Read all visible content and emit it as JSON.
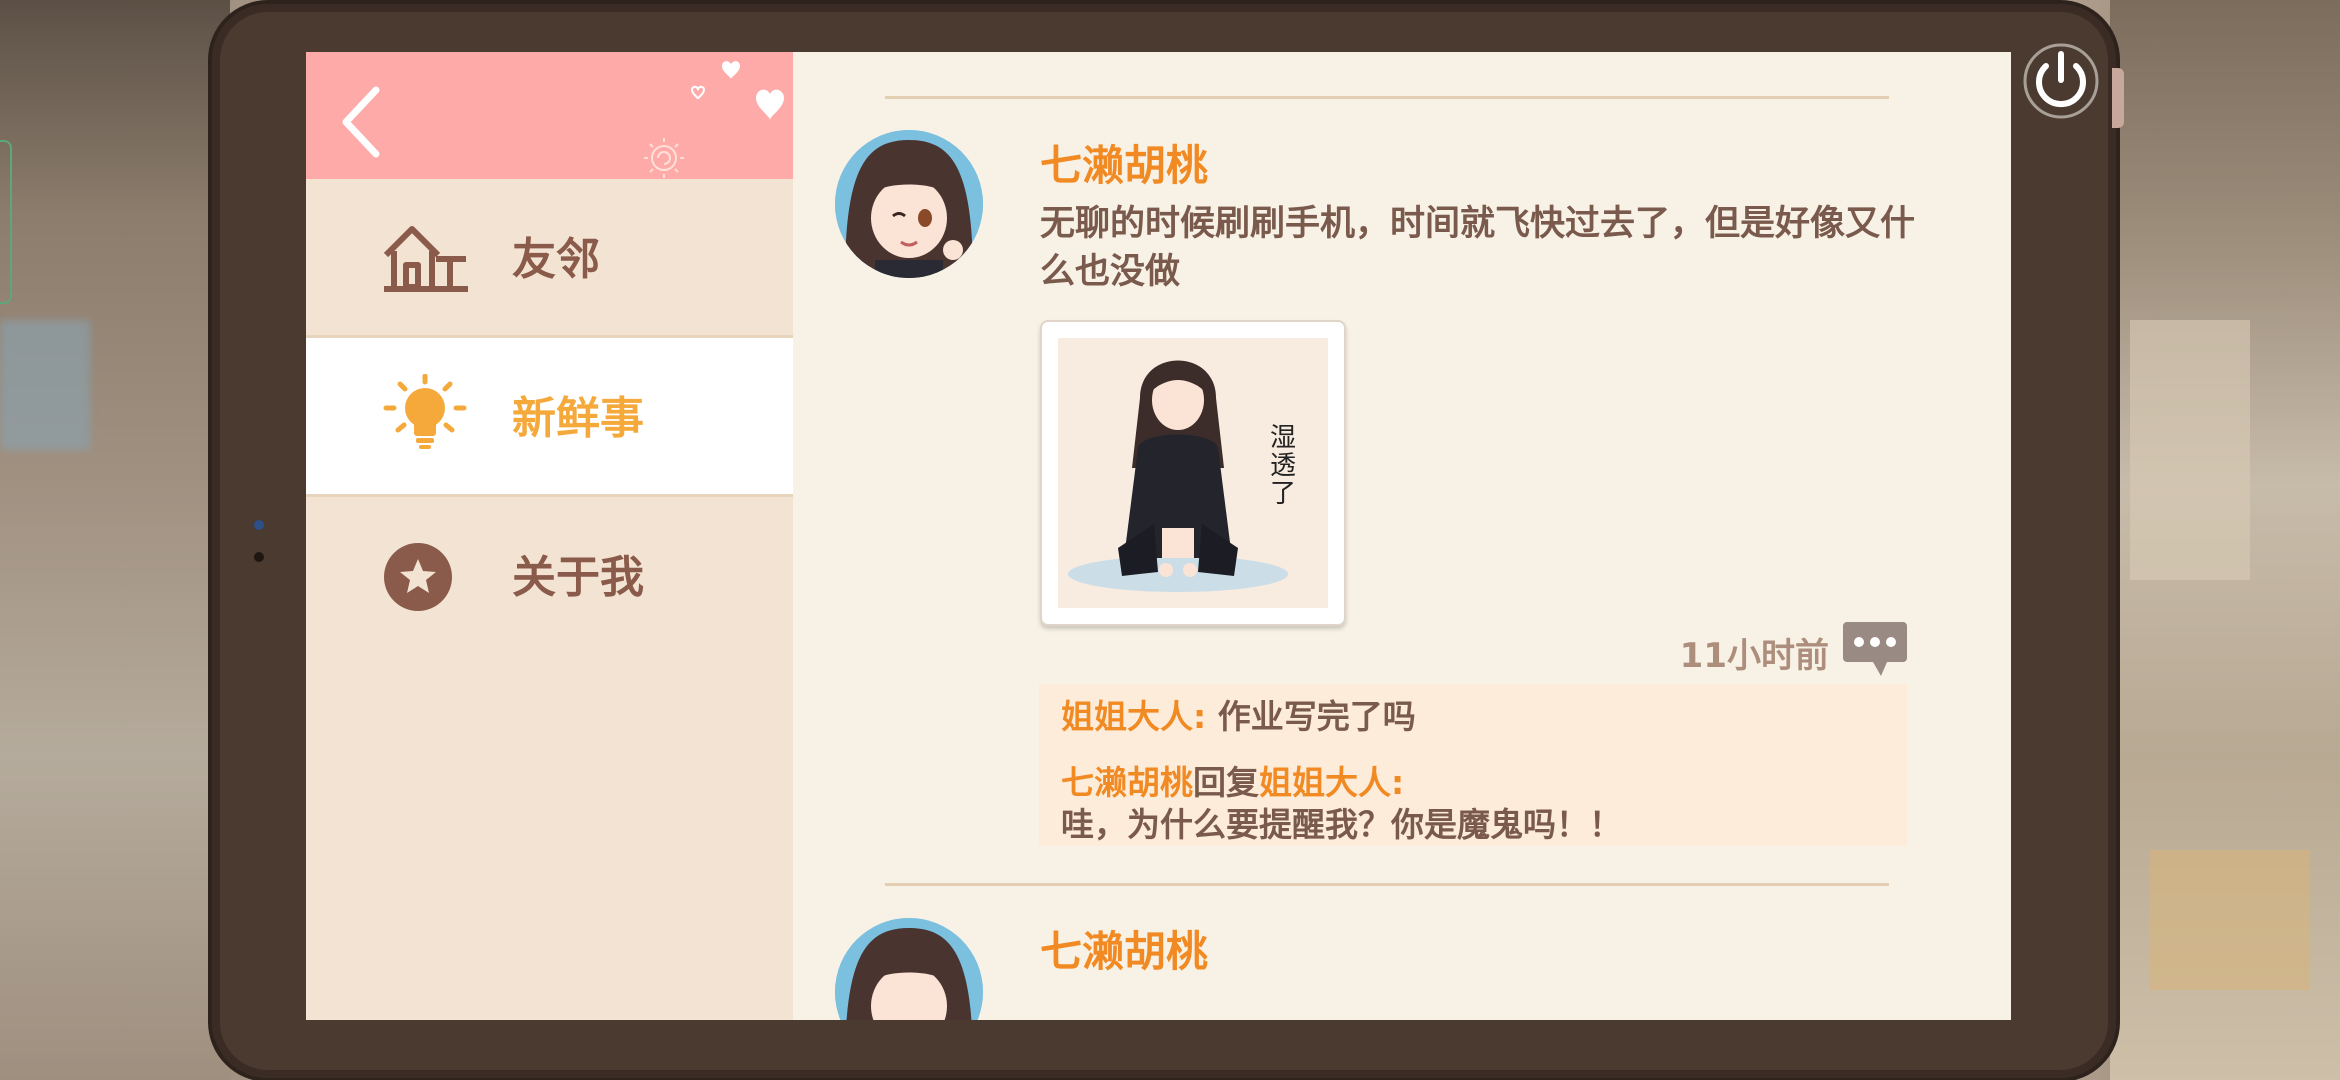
{
  "sidebar": {
    "items": [
      {
        "label": "友邻",
        "icon": "house-icon"
      },
      {
        "label": "新鲜事",
        "icon": "lightbulb-icon"
      },
      {
        "label": "关于我",
        "icon": "star-icon"
      }
    ],
    "active_index": 1
  },
  "feed": {
    "posts": [
      {
        "author": "七濑胡桃",
        "text": "无聊的时候刷刷手机，时间就飞快过去了，但是好像又什么也没做",
        "image_caption": "湿透了",
        "time": "11小时前",
        "comments": [
          {
            "author": "姐姐大人",
            "sep": ": ",
            "text": "作业写完了吗"
          },
          {
            "author": "七濑胡桃",
            "reply_word": "回复",
            "reply_to": "姐姐大人",
            "sep": ":",
            "text": "哇，为什么要提醒我？你是魔鬼吗！！"
          }
        ]
      },
      {
        "author": "七濑胡桃"
      }
    ]
  },
  "colors": {
    "header_pink": "#fdaaa8",
    "accent_orange": "#f28a24",
    "active_yellow": "#f6a93b",
    "text_brown": "#7a5a4c",
    "frame": "#4a3a30"
  }
}
